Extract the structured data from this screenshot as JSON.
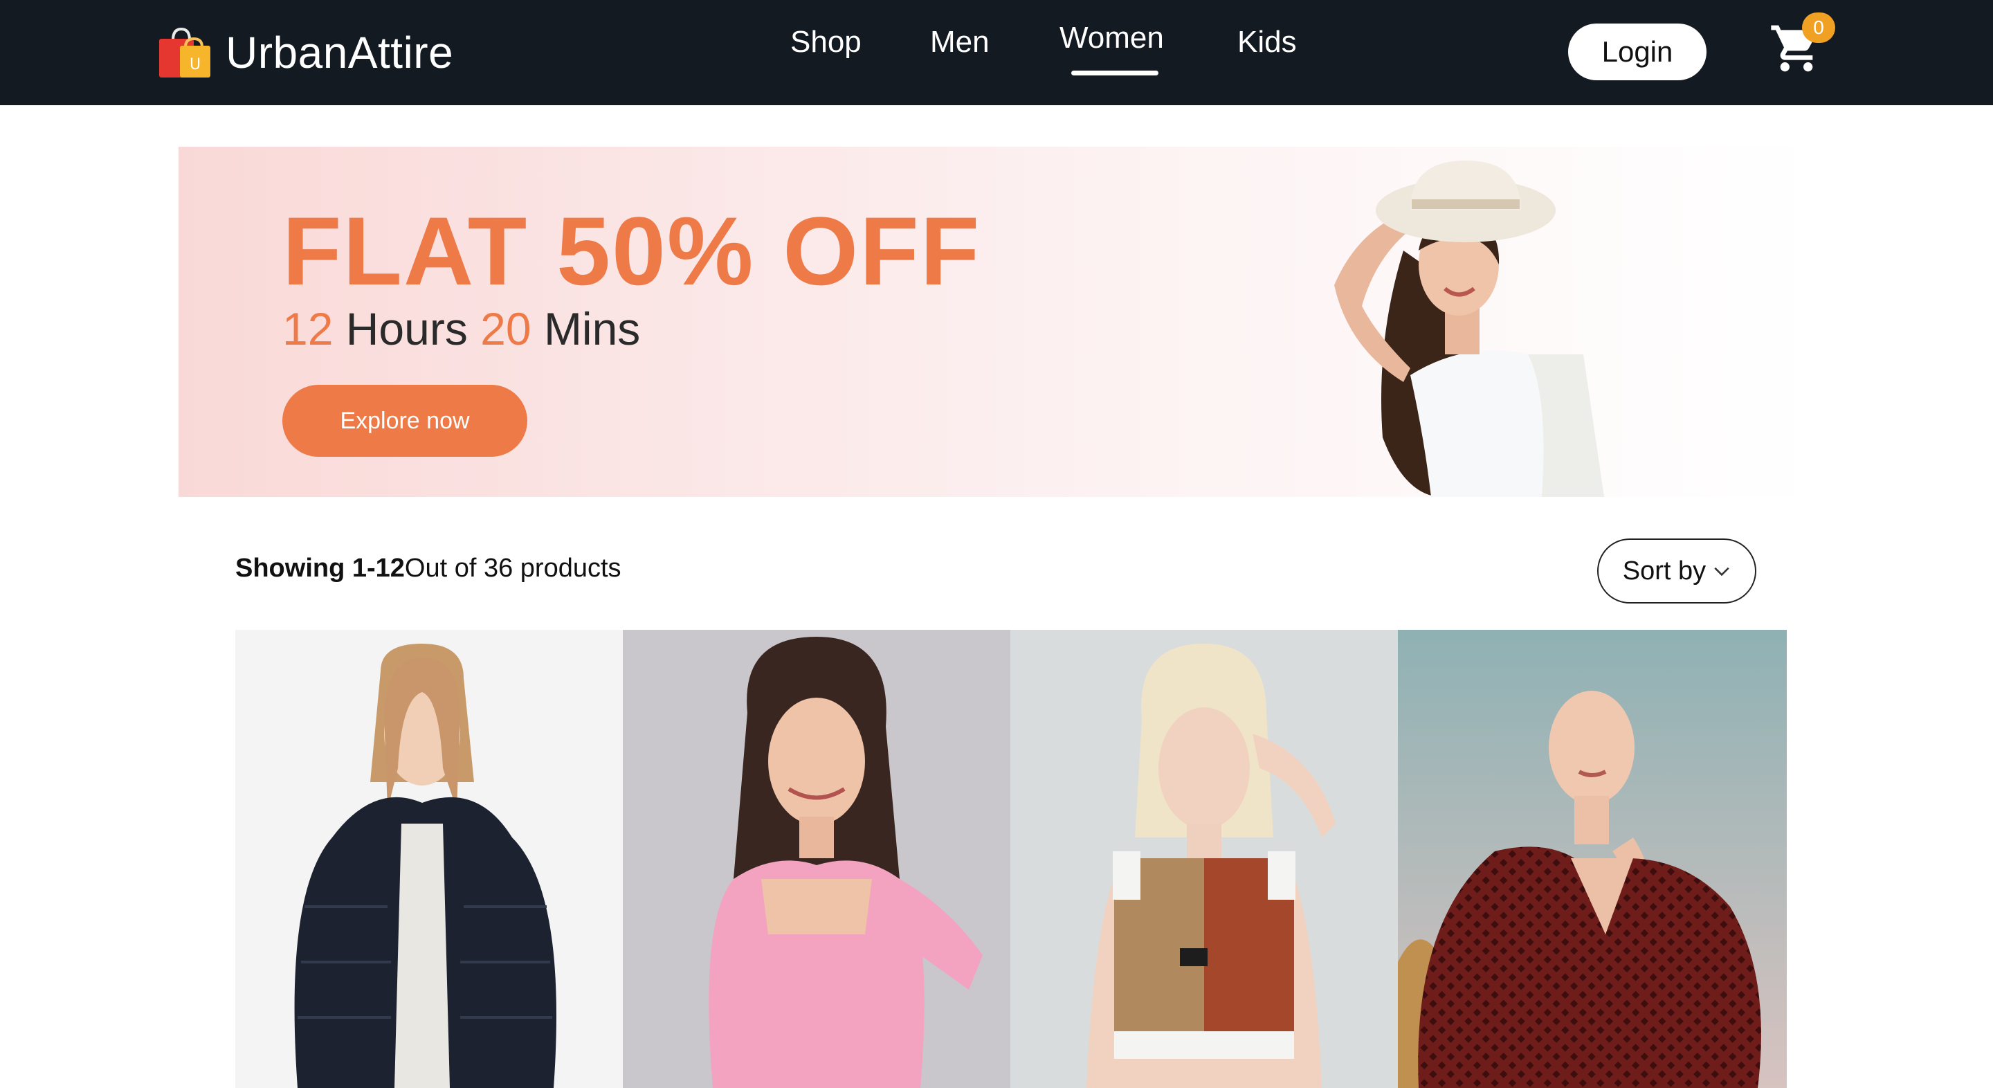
{
  "brand": {
    "name": "UrbanAttire",
    "logo_icon": "shopping-bag-icon",
    "logo_letter": "U"
  },
  "nav": {
    "items": [
      {
        "label": "Shop",
        "active": false
      },
      {
        "label": "Men",
        "active": false
      },
      {
        "label": "Women",
        "active": true
      },
      {
        "label": "Kids",
        "active": false
      }
    ],
    "login_label": "Login",
    "cart_icon": "cart-icon",
    "cart_count": "0"
  },
  "hero": {
    "title": "FLAT 50% OFF",
    "timer": {
      "hours": "12",
      "hours_label": "Hours",
      "mins": "20",
      "mins_label": "Mins"
    },
    "cta_label": "Explore now",
    "image": "woman-in-hat-image"
  },
  "listing": {
    "showing_bold": "Showing 1-12",
    "showing_rest": "Out of 36 products",
    "sort_label": "Sort by",
    "sort_icon": "chevron-down-icon"
  },
  "products": [
    {
      "image": "woman-black-fur-jacket"
    },
    {
      "image": "woman-pink-top"
    },
    {
      "image": "woman-sports-crop-top"
    },
    {
      "image": "woman-red-patterned-dress"
    }
  ],
  "colors": {
    "nav_bg": "#141a22",
    "accent": "#ee7a48",
    "badge": "#f0a022"
  }
}
